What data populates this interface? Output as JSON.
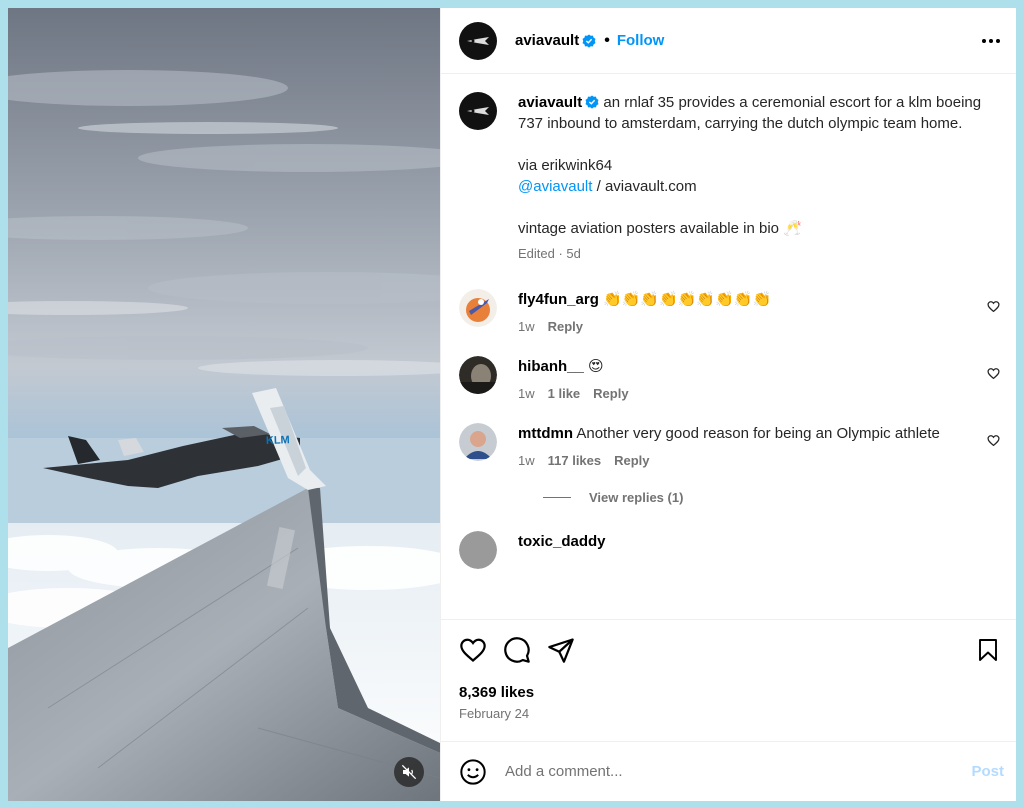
{
  "post": {
    "username": "aviavault",
    "follow_label": "Follow",
    "separator": "•",
    "caption_lines": [
      "an rnlaf 35 provides a ceremonial escort for a klm boeing 737 inbound to amsterdam, carrying the dutch olympic team home."
    ],
    "via_text": "via erikwink64",
    "mention": "@aviavault",
    "site_text": " / aviavault.com",
    "posters_text": "vintage aviation posters available in bio 🥂",
    "caption_meta": "Edited · 5d",
    "likes": "8,369 likes",
    "date": "February 24"
  },
  "comments": [
    {
      "username": "fly4fun_arg",
      "text": "👏👏👏👏👏👏👏👏👏",
      "time": "1w",
      "likes": "",
      "reply": "Reply"
    },
    {
      "username": "hibanh__",
      "text": "😍",
      "time": "1w",
      "likes": "1 like",
      "reply": "Reply"
    },
    {
      "username": "mttdmn",
      "text": "Another very good reason for being an Olympic athlete",
      "time": "1w",
      "likes": "117 likes",
      "reply": "Reply"
    },
    {
      "username": "toxic_daddy",
      "text": "",
      "time": "",
      "likes": "",
      "reply": ""
    }
  ],
  "view_replies": "View replies (1)",
  "add_comment": {
    "placeholder": "Add a comment...",
    "post_label": "Post"
  },
  "icons": {
    "like": "heart-icon",
    "comment": "comment-bubble-icon",
    "share": "paper-plane-icon",
    "save": "bookmark-icon",
    "emoji": "smiley-icon",
    "mute": "speaker-muted-icon",
    "more": "more-options-icon"
  },
  "colors": {
    "accent": "#0095f6",
    "frame": "#aee0ec",
    "post_disabled": "#b3dbff"
  }
}
